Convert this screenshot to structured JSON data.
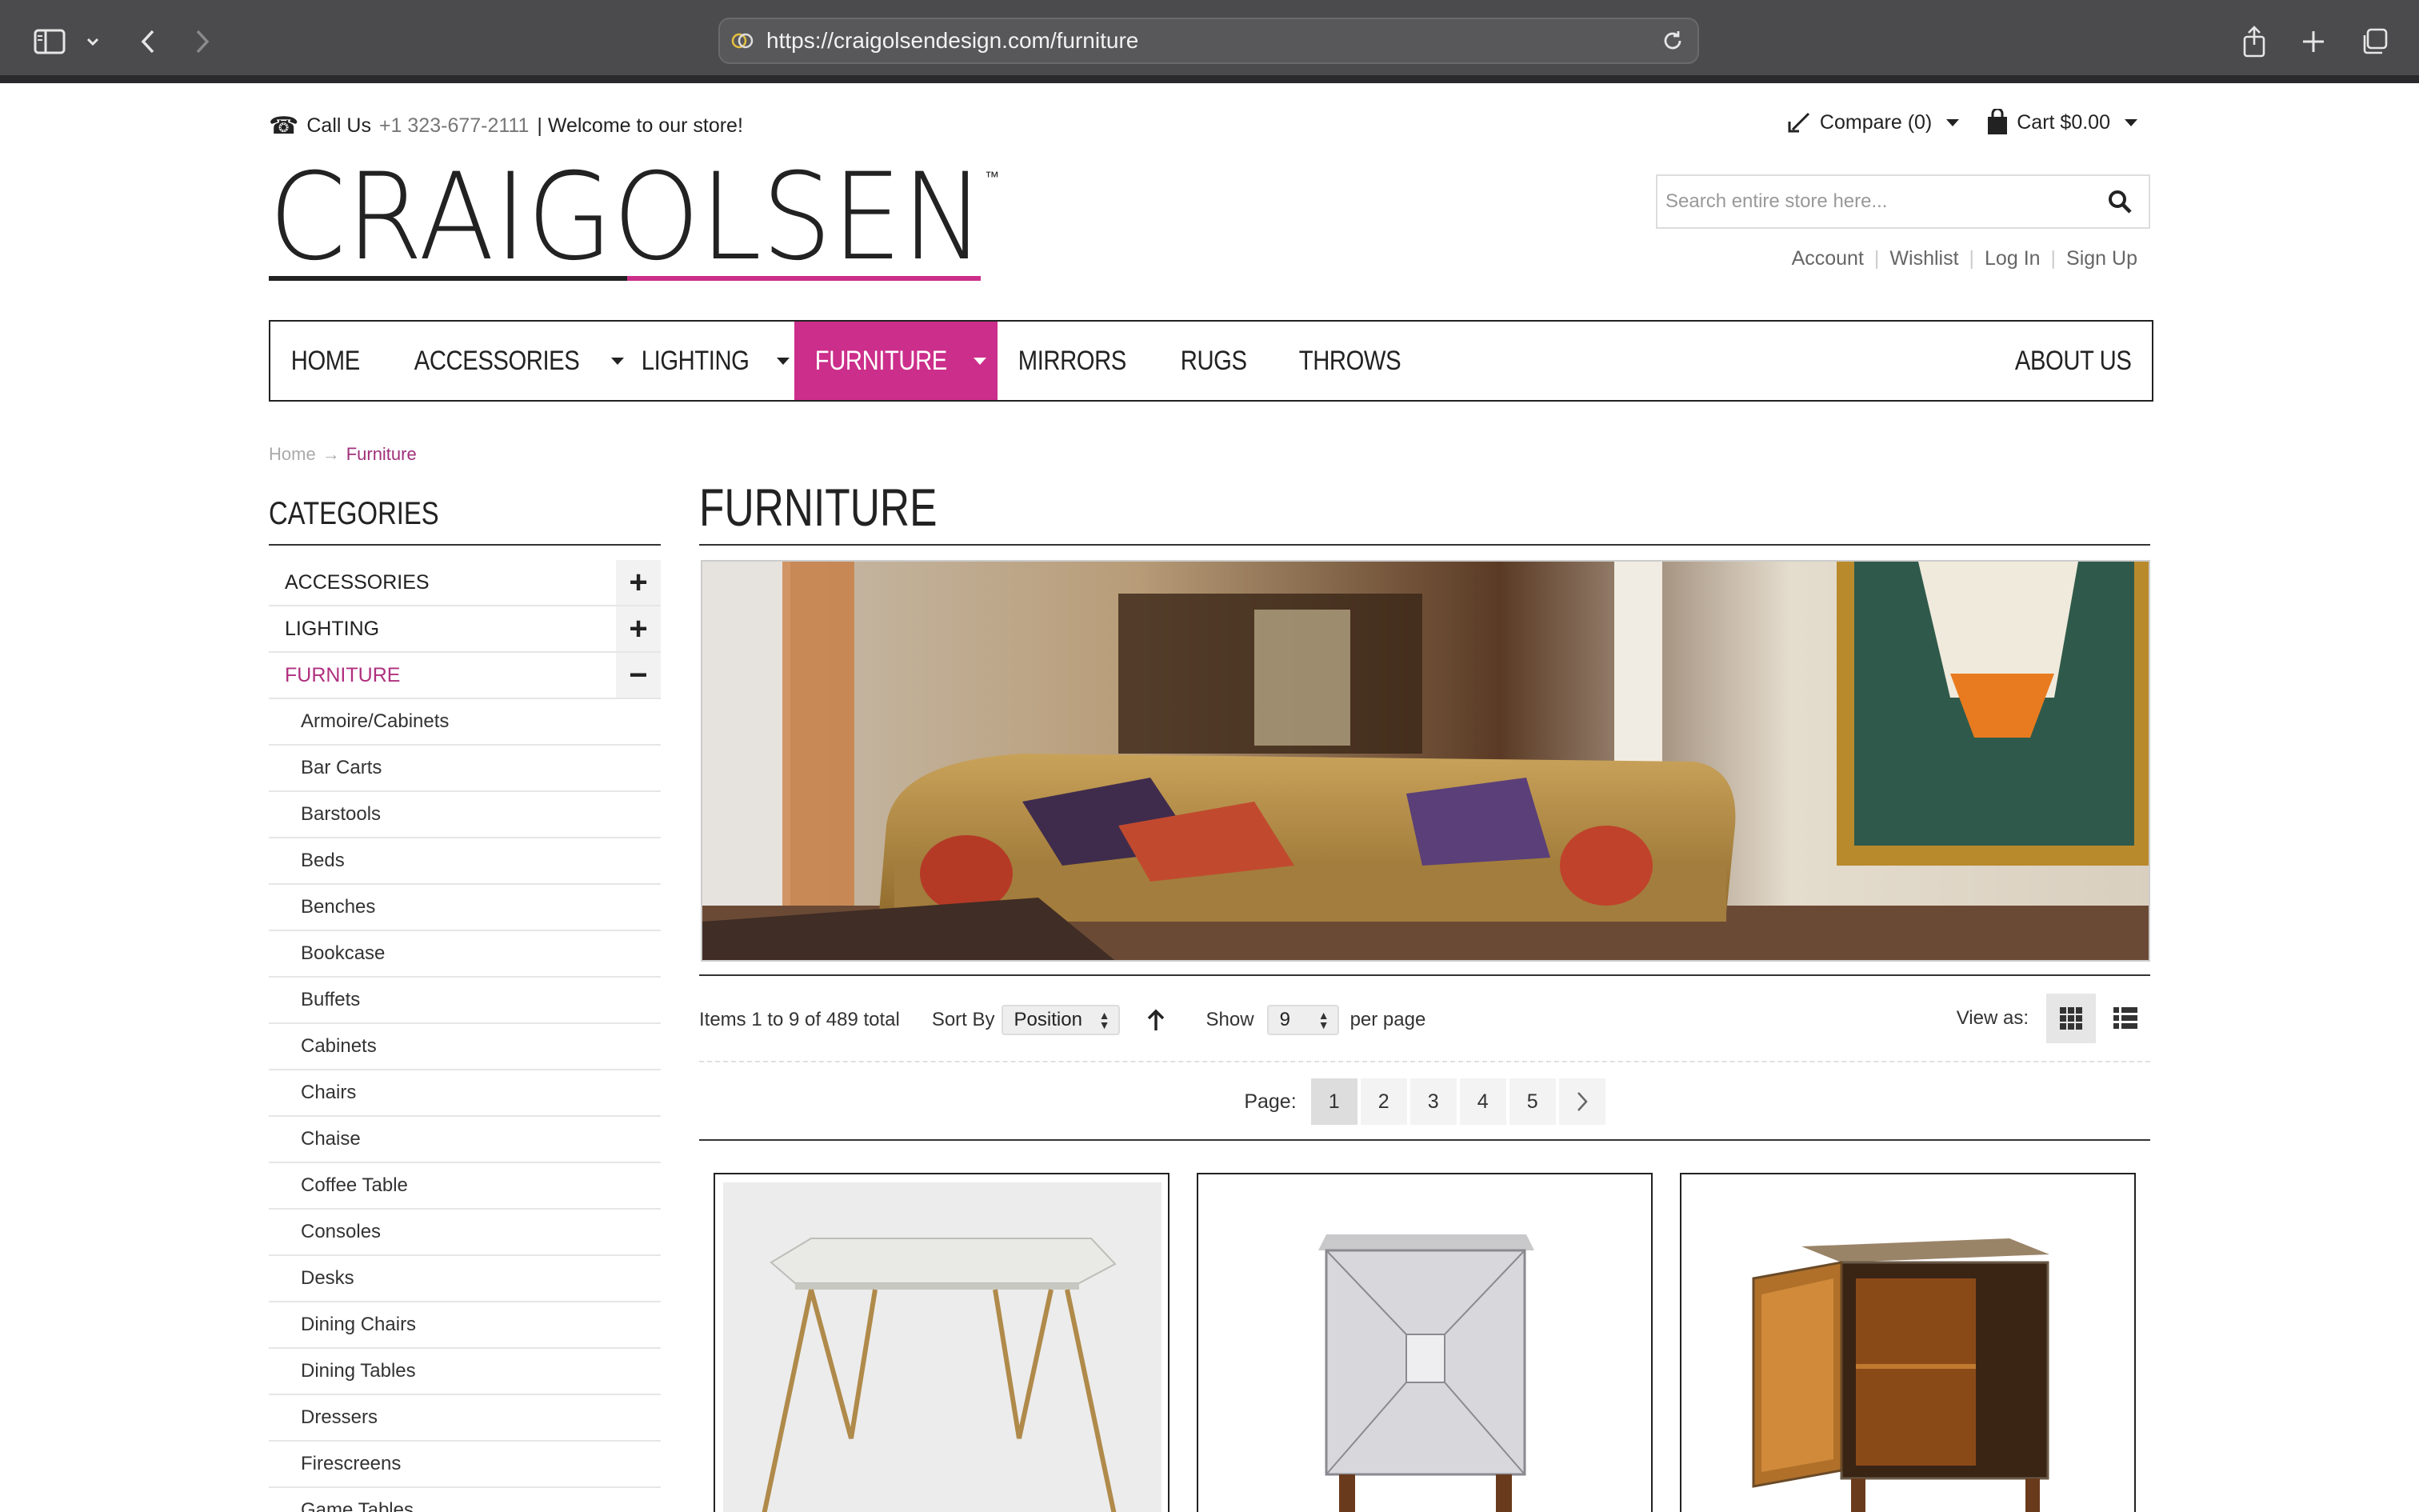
{
  "browser": {
    "url": "https://craigolsendesign.com/furniture"
  },
  "header": {
    "call_label": "Call Us",
    "phone": "+1 323-677-2111",
    "welcome": "| Welcome to our store!",
    "compare": "Compare (0)",
    "cart": "Cart $0.00",
    "logo_text": "CRAIGOLSEN",
    "search_placeholder": "Search entire store here...",
    "account_links": [
      "Account",
      "Wishlist",
      "Log In",
      "Sign Up"
    ]
  },
  "nav": {
    "items": [
      {
        "label": "HOME",
        "dropdown": false
      },
      {
        "label": "ACCESSORIES",
        "dropdown": true
      },
      {
        "label": "LIGHTING",
        "dropdown": true
      },
      {
        "label": "FURNITURE",
        "dropdown": true,
        "active": true
      },
      {
        "label": "MIRRORS",
        "dropdown": false
      },
      {
        "label": "RUGS",
        "dropdown": false
      },
      {
        "label": "THROWS",
        "dropdown": false
      }
    ],
    "about": "ABOUT US",
    "active_color": "#cc2e8b"
  },
  "breadcrumb": {
    "home": "Home",
    "current": "Furniture"
  },
  "sidebar": {
    "title": "CATEGORIES",
    "top": [
      {
        "label": "ACCESSORIES",
        "toggle": "+"
      },
      {
        "label": "LIGHTING",
        "toggle": "+"
      },
      {
        "label": "FURNITURE",
        "toggle": "−"
      }
    ],
    "subs": [
      "Armoire/Cabinets",
      "Bar Carts",
      "Barstools",
      "Beds",
      "Benches",
      "Bookcase",
      "Buffets",
      "Cabinets",
      "Chairs",
      "Chaise",
      "Coffee Table",
      "Consoles",
      "Desks",
      "Dining Chairs",
      "Dining Tables",
      "Dressers",
      "Firescreens",
      "Game Tables"
    ]
  },
  "main": {
    "title": "FURNITURE",
    "items_text": "Items 1 to 9 of 489 total",
    "sort_label": "Sort By",
    "sort_value": "Position",
    "show_label": "Show",
    "show_value": "9",
    "per_page": "per page",
    "view_as": "View as:",
    "page_label": "Page:",
    "pages": [
      "1",
      "2",
      "3",
      "4",
      "5"
    ]
  }
}
